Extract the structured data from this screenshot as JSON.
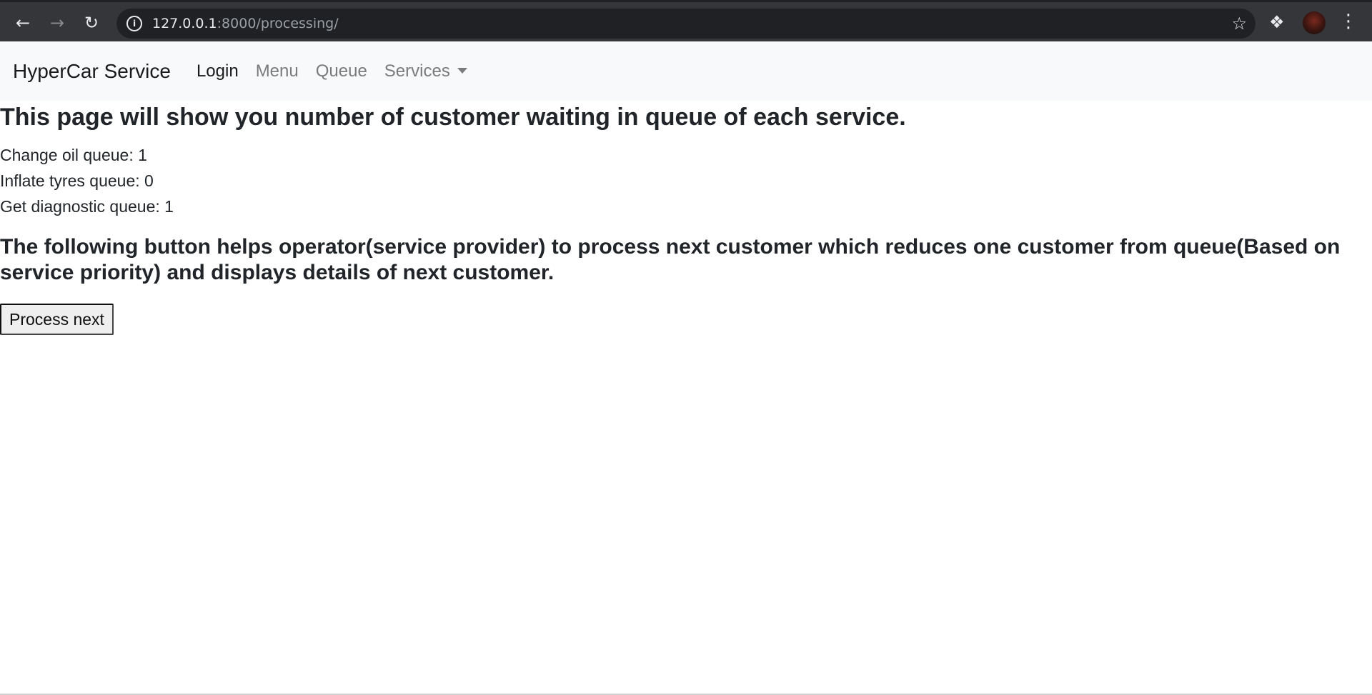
{
  "browser": {
    "url_host": "127.0.0.1",
    "url_path": ":8000/processing/",
    "icons": {
      "back": "back-arrow-icon",
      "forward": "forward-arrow-icon",
      "reload": "reload-icon",
      "info": "info-icon",
      "star": "star-icon",
      "extensions": "puzzle-icon",
      "menu": "vertical-dots-icon"
    }
  },
  "navbar": {
    "brand": "HyperCar Service",
    "links": [
      {
        "label": "Login",
        "active": true
      },
      {
        "label": "Menu",
        "active": false
      },
      {
        "label": "Queue",
        "active": false
      },
      {
        "label": "Services",
        "active": false,
        "dropdown": true
      }
    ]
  },
  "main": {
    "heading": "This page will show you number of customer waiting in queue of each service.",
    "queues": [
      {
        "label": "Change oil queue: 1"
      },
      {
        "label": "Inflate tyres queue: 0"
      },
      {
        "label": "Get diagnostic queue: 1"
      }
    ],
    "info": "The following button helps operator(service provider) to process next customer which reduces one customer from queue(Based on service priority) and displays details of next customer.",
    "button_label": "Process next"
  },
  "colors": {
    "browser_bar": "#35363a",
    "omnibox": "#202124",
    "navbar_bg": "#f8f9fa",
    "text": "#212529",
    "nav_muted": "#7a7b7c"
  }
}
